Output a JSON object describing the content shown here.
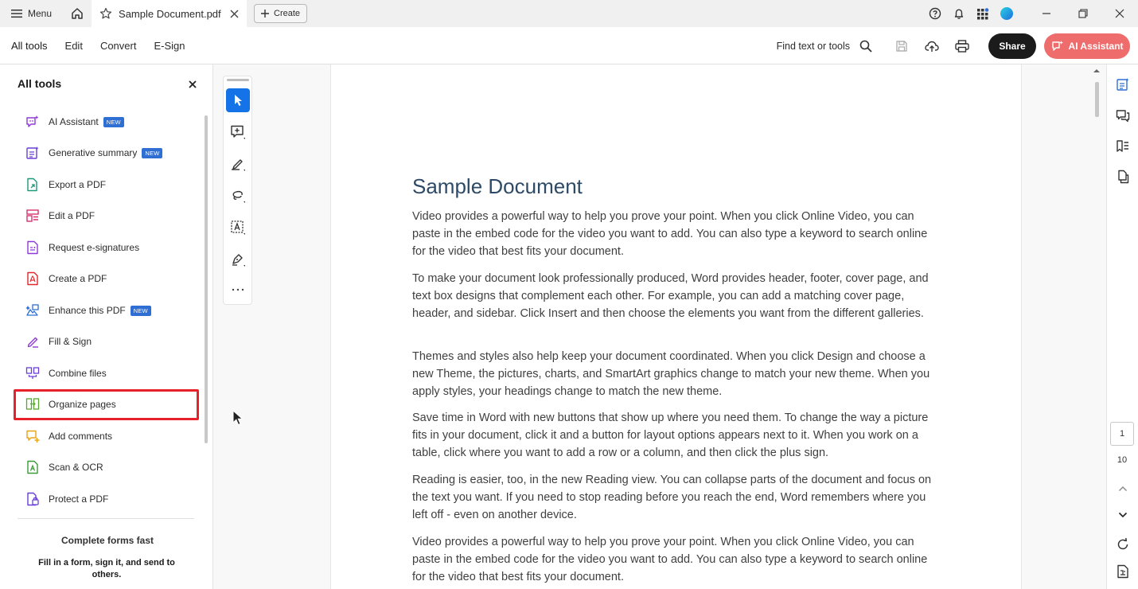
{
  "titlebar": {
    "menu_label": "Menu",
    "tab_title": "Sample Document.pdf",
    "create_label": "Create"
  },
  "toolbar": {
    "tabs": [
      {
        "label": "All tools",
        "active": true
      },
      {
        "label": "Edit",
        "active": false
      },
      {
        "label": "Convert",
        "active": false
      },
      {
        "label": "E-Sign",
        "active": false
      }
    ],
    "find_label": "Find text or tools",
    "share_label": "Share",
    "ai_label": "AI Assistant"
  },
  "left_panel": {
    "title": "All tools",
    "items": [
      {
        "label": "AI Assistant",
        "badge": "NEW",
        "icon": "ai-assistant-icon"
      },
      {
        "label": "Generative summary",
        "badge": "NEW",
        "icon": "summary-icon"
      },
      {
        "label": "Export a PDF",
        "badge": "",
        "icon": "export-pdf-icon"
      },
      {
        "label": "Edit a PDF",
        "badge": "",
        "icon": "edit-pdf-icon"
      },
      {
        "label": "Request e-signatures",
        "badge": "",
        "icon": "esign-icon"
      },
      {
        "label": "Create a PDF",
        "badge": "",
        "icon": "create-pdf-icon"
      },
      {
        "label": "Enhance this PDF",
        "badge": "NEW",
        "icon": "enhance-icon"
      },
      {
        "label": "Fill & Sign",
        "badge": "",
        "icon": "fill-sign-icon"
      },
      {
        "label": "Combine files",
        "badge": "",
        "icon": "combine-icon"
      },
      {
        "label": "Organize pages",
        "badge": "",
        "icon": "organize-icon"
      },
      {
        "label": "Add comments",
        "badge": "",
        "icon": "comment-icon"
      },
      {
        "label": "Scan & OCR",
        "badge": "",
        "icon": "scan-icon"
      },
      {
        "label": "Protect a PDF",
        "badge": "",
        "icon": "protect-icon"
      }
    ],
    "promo_title": "Complete forms fast",
    "promo_sub": "Fill in a form, sign it, and send to others."
  },
  "document": {
    "title": "Sample Document",
    "paragraphs": [
      "Video provides a powerful way to help you prove your point. When you click Online Video, you can paste in the embed code for the video you want to add. You can also type a keyword to search online for the video that best fits your document.",
      "To make your document look professionally produced, Word provides header, footer, cover page, and text box designs that complement each other. For example, you can add a matching cover page, header, and sidebar. Click Insert and then choose the elements you want from the different galleries.",
      "Themes and styles also help keep your document coordinated. When you click Design and choose a new Theme, the pictures, charts, and SmartArt graphics change to match your new theme. When you apply styles, your headings change to match the new theme.",
      "Save time in Word with new buttons that show up where you need them. To change the way a picture fits in your document, click it and a button for layout options appears next to it. When you work on a table, click where you want to add a row or a column, and then click the plus sign.",
      "Reading is easier, too, in the new Reading view. You can collapse parts of the document and focus on the text you want. If you need to stop reading before you reach the end, Word remembers where you left off - even on another device.",
      "Video provides a powerful way to help you prove your point. When you click Online Video, you can paste in the embed code for the video you want to add. You can also type a keyword to search online for the video that best fits your document."
    ]
  },
  "pager": {
    "current": "1",
    "total": "10"
  },
  "colors": {
    "accent": "#1473e6",
    "ai_button": "#ee6c6c",
    "highlight": "#e8202a",
    "doc_title": "#2d4a66"
  }
}
